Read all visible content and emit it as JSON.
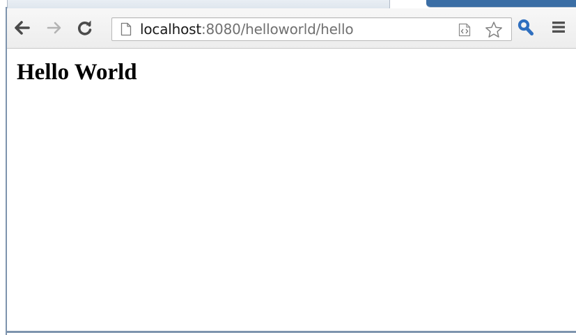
{
  "toolbar": {
    "url_host": "localhost",
    "url_rest": ":8080/helloworld/hello",
    "icons": {
      "back": "back-arrow-icon",
      "forward": "forward-arrow-icon",
      "reload": "reload-icon",
      "page": "page-icon",
      "extension": "page-source-icon",
      "bookmark": "star-icon",
      "search_extension": "search-icon",
      "menu": "menu-icon"
    }
  },
  "page": {
    "heading": "Hello World"
  },
  "colors": {
    "accent": "#3b6ea5",
    "search_icon": "#2f6fbf"
  }
}
